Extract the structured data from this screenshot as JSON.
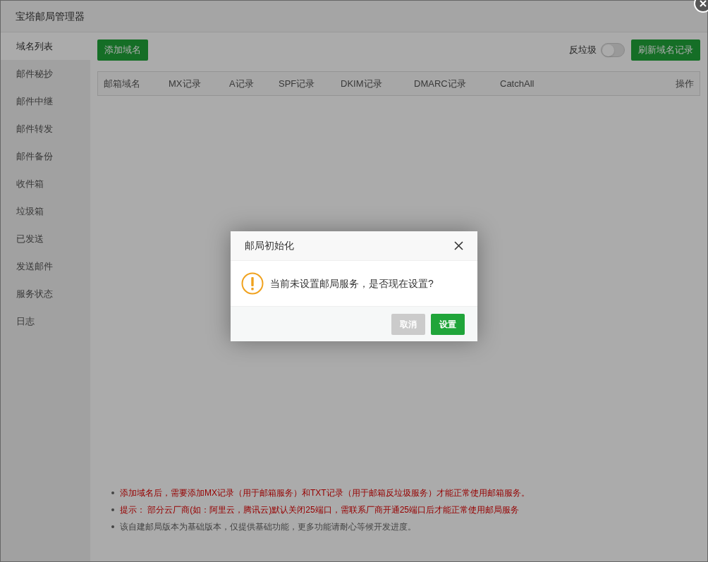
{
  "window": {
    "title": "宝塔邮局管理器"
  },
  "sidebar": {
    "items": [
      {
        "label": "域名列表",
        "selected": true
      },
      {
        "label": "邮件秘抄",
        "selected": false
      },
      {
        "label": "邮件中继",
        "selected": false
      },
      {
        "label": "邮件转发",
        "selected": false
      },
      {
        "label": "邮件备份",
        "selected": false
      },
      {
        "label": "收件箱",
        "selected": false
      },
      {
        "label": "垃圾箱",
        "selected": false
      },
      {
        "label": "已发送",
        "selected": false
      },
      {
        "label": "发送邮件",
        "selected": false
      },
      {
        "label": "服务状态",
        "selected": false
      },
      {
        "label": "日志",
        "selected": false
      }
    ]
  },
  "toolbar": {
    "add_button": "添加域名",
    "antispam": {
      "label": "反垃圾",
      "on": false
    },
    "refresh_button": "刷新域名记录"
  },
  "table": {
    "columns": [
      "邮箱域名",
      "MX记录",
      "A记录",
      "SPF记录",
      "DKIM记录",
      "DMARC记录",
      "CatchAll",
      "操作"
    ]
  },
  "notes": [
    {
      "kind": "warning",
      "text": "添加域名后，需要添加MX记录（用于邮箱服务）和TXT记录（用于邮箱反垃圾服务）才能正常使用邮箱服务。"
    },
    {
      "kind": "warning",
      "text": "提示： 部分云厂商(如：阿里云，腾讯云)默认关闭25端口，需联系厂商开通25端口后才能正常使用邮局服务"
    },
    {
      "kind": "info",
      "text": "该自建邮局版本为基础版本，仅提供基础功能，更多功能请耐心等候开发进度。"
    }
  ],
  "dialog": {
    "title": "邮局初始化",
    "message": "当前未设置邮局服务，是否现在设置?",
    "buttons": [
      {
        "label": "取消",
        "kind": "secondary"
      },
      {
        "label": "设置",
        "kind": "primary"
      }
    ]
  }
}
